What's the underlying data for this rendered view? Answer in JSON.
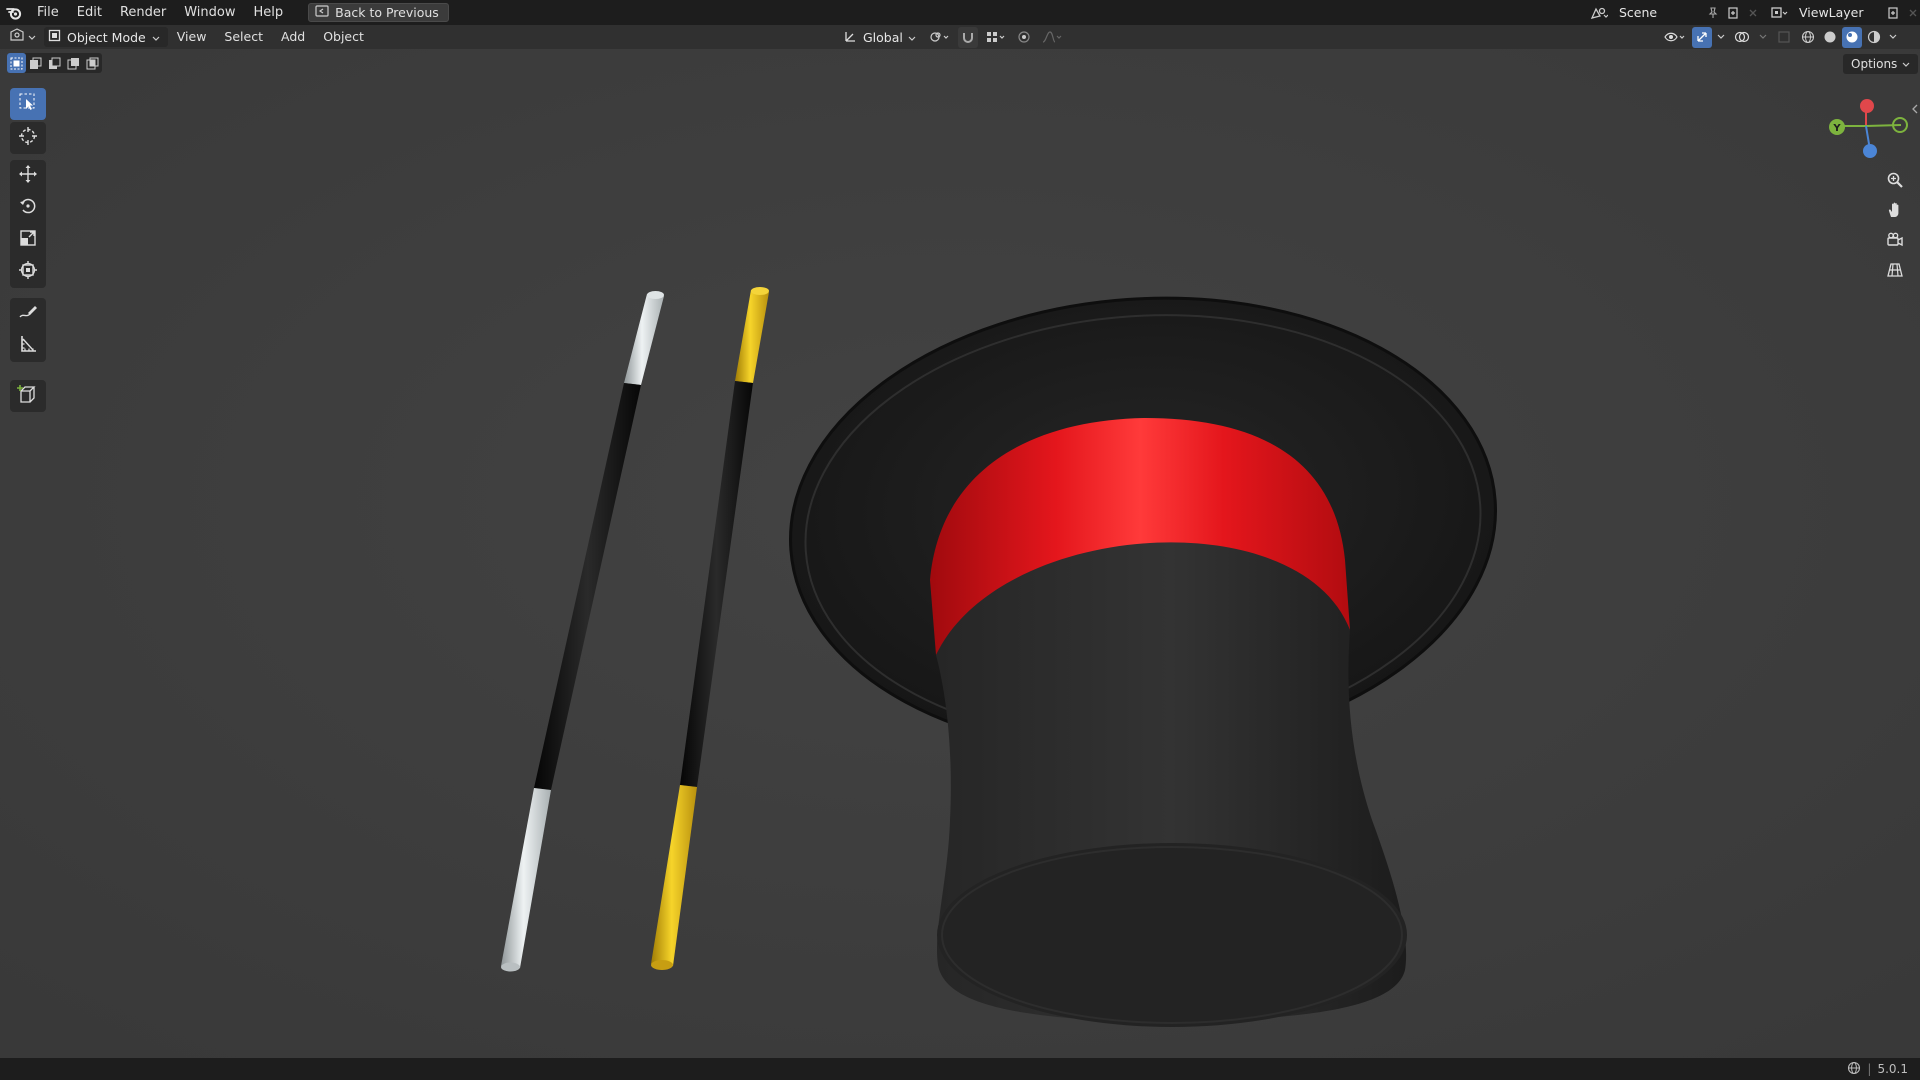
{
  "menubar": {
    "items": [
      "File",
      "Edit",
      "Render",
      "Window",
      "Help"
    ],
    "back_button": "Back to Previous",
    "scene_name": "Scene",
    "view_layer_name": "ViewLayer"
  },
  "header": {
    "mode": "Object Mode",
    "menus": [
      "View",
      "Select",
      "Add",
      "Object"
    ],
    "orientation": "Global",
    "options_label": "Options"
  },
  "toolbar": {
    "tools": [
      "select-box",
      "cursor",
      "move",
      "rotate",
      "scale",
      "transform",
      "annotate",
      "measure",
      "add-cube"
    ],
    "active_tool": "select-box"
  },
  "gizmo": {
    "axes": [
      "Y"
    ]
  },
  "status": {
    "version": "5.0.1"
  },
  "colors": {
    "accent": "#4772b3",
    "hat_band": "#e0141a",
    "wand_gold": "#e8c21a",
    "wand_silver": "#c8cfd2"
  }
}
